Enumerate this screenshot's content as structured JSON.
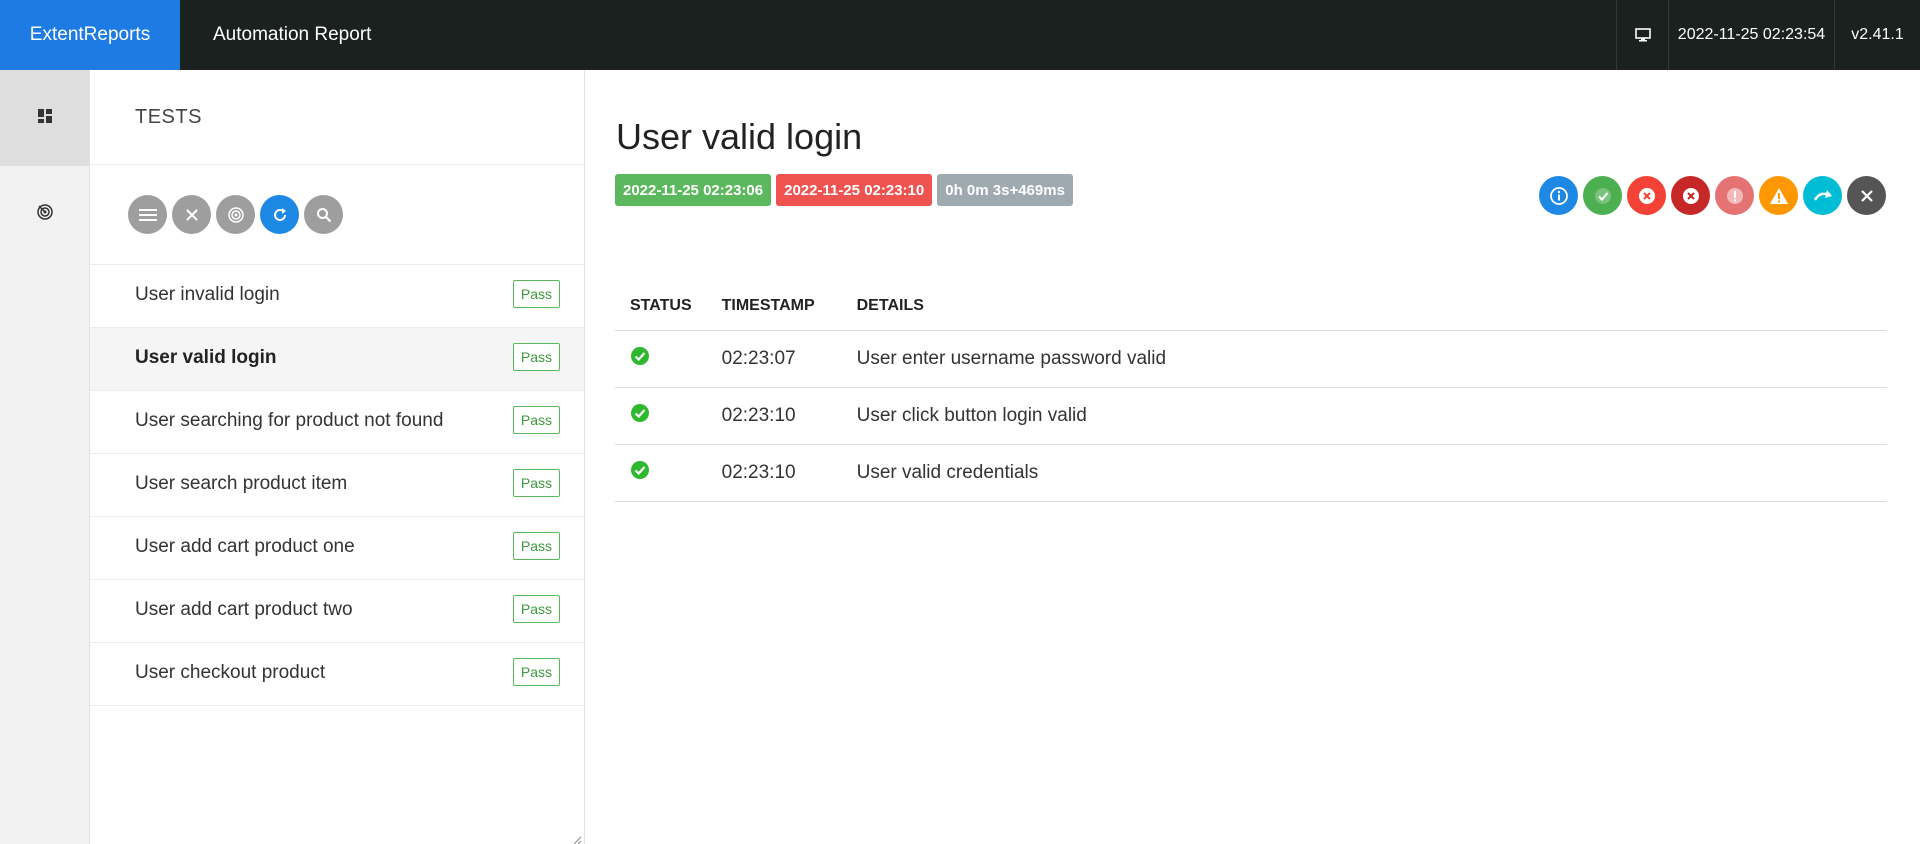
{
  "header": {
    "brand": "ExtentReports",
    "title": "Automation Report",
    "timestamp": "2022-11-25 02:23:54",
    "version": "v2.41.1",
    "monitor_icon": "monitor-icon"
  },
  "rail": {
    "items": [
      {
        "icon": "dashboard-icon",
        "active": true
      },
      {
        "icon": "radar-icon",
        "active": false
      }
    ]
  },
  "tests_panel": {
    "heading": "TESTS",
    "tools": [
      "list-icon",
      "close-icon",
      "radar-icon",
      "refresh-icon",
      "search-icon"
    ],
    "items": [
      {
        "name": "User invalid login",
        "status": "Pass"
      },
      {
        "name": "User valid login",
        "status": "Pass",
        "selected": true
      },
      {
        "name": "User searching for product not found",
        "status": "Pass"
      },
      {
        "name": "User search product item",
        "status": "Pass"
      },
      {
        "name": "User add cart product one",
        "status": "Pass"
      },
      {
        "name": "User add cart product two",
        "status": "Pass"
      },
      {
        "name": "User checkout product",
        "status": "Pass"
      }
    ]
  },
  "detail": {
    "title": "User valid login",
    "start_time": "2022-11-25 02:23:06",
    "end_time": "2022-11-25 02:23:10",
    "duration": "0h 0m 3s+469ms",
    "colors": {
      "pass": "#5cb85c",
      "fail": "#ef5350",
      "duration": "#9eaab0"
    },
    "filter_buttons": [
      {
        "icon": "info-icon",
        "color": "#1e88e5"
      },
      {
        "icon": "pass-check-icon",
        "color": "#4caf50"
      },
      {
        "icon": "fail-icon",
        "color": "#f44336"
      },
      {
        "icon": "fatal-icon",
        "color": "#c62828"
      },
      {
        "icon": "error-icon",
        "color": "#e57373"
      },
      {
        "icon": "warning-icon",
        "color": "#ff9800"
      },
      {
        "icon": "skip-icon",
        "color": "#00bcd4"
      },
      {
        "icon": "clear-icon",
        "color": "#555555"
      }
    ],
    "table": {
      "headers": [
        "STATUS",
        "TIMESTAMP",
        "DETAILS"
      ],
      "rows": [
        {
          "status": "pass",
          "timestamp": "02:23:07",
          "details": "User enter username password valid"
        },
        {
          "status": "pass",
          "timestamp": "02:23:10",
          "details": "User click button login valid"
        },
        {
          "status": "pass",
          "timestamp": "02:23:10",
          "details": "User valid credentials"
        }
      ]
    }
  }
}
